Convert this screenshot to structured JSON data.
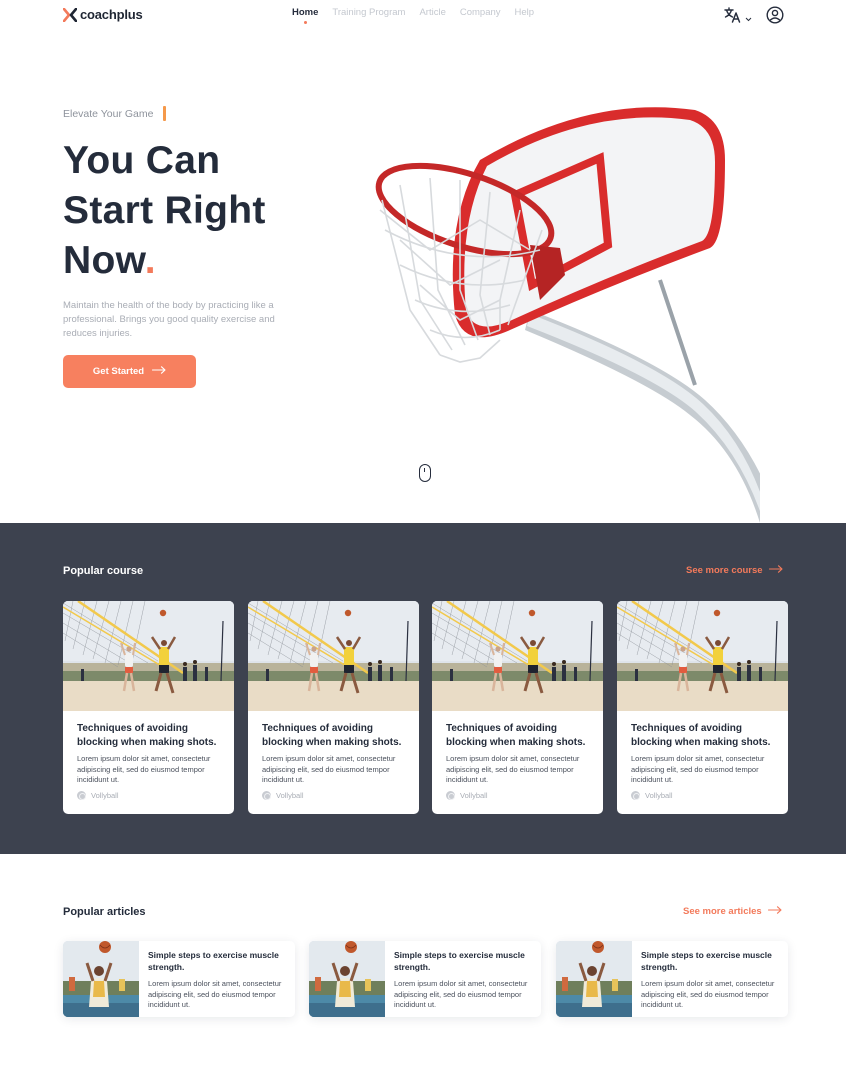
{
  "nav": {
    "logo_text": "coachplus",
    "items": [
      {
        "label": "Home",
        "active": true
      },
      {
        "label": "Training Program",
        "active": false
      },
      {
        "label": "Article",
        "active": false
      },
      {
        "label": "Company",
        "active": false
      },
      {
        "label": "Help",
        "active": false
      }
    ],
    "icons": {
      "language": "translate-icon",
      "dropdown": "chevron-down-icon",
      "account": "user-circle-icon"
    }
  },
  "hero": {
    "eyebrow": "Elevate Your Game",
    "title_line1": "You Can",
    "title_line2": "Start Right",
    "title_line3": "Now",
    "title_dot": ".",
    "description": "Maintain the health of the body by practicing like a professional. Brings you good quality exercise and reduces injuries.",
    "cta_label": "Get Started"
  },
  "courses": {
    "title": "Popular course",
    "see_more": "See more course",
    "items": [
      {
        "title": "Techniques of avoiding blocking when making shots.",
        "description": "Lorem ipsum dolor sit amet, consectetur adipiscing elit, sed do eiusmod tempor incididunt ut.",
        "tag": "Vollyball"
      },
      {
        "title": "Techniques of avoiding blocking when making shots.",
        "description": "Lorem ipsum dolor sit amet, consectetur adipiscing elit, sed do eiusmod tempor incididunt ut.",
        "tag": "Vollyball"
      },
      {
        "title": "Techniques of avoiding blocking when making shots.",
        "description": "Lorem ipsum dolor sit amet, consectetur adipiscing elit, sed do eiusmod tempor incididunt ut.",
        "tag": "Vollyball"
      },
      {
        "title": "Techniques of avoiding blocking when making shots.",
        "description": "Lorem ipsum dolor sit amet, consectetur adipiscing elit, sed do eiusmod tempor incididunt ut.",
        "tag": "Vollyball"
      }
    ]
  },
  "articles": {
    "title": "Popular articles",
    "see_more": "See more articles",
    "items": [
      {
        "title": "Simple steps to exercise muscle strength.",
        "description": "Lorem ipsum dolor sit amet, consectetur adipiscing elit, sed do eiusmod tempor incididunt ut."
      },
      {
        "title": "Simple steps to exercise muscle strength.",
        "description": "Lorem ipsum dolor sit amet, consectetur adipiscing elit, sed do eiusmod tempor incididunt ut."
      },
      {
        "title": "Simple steps to exercise muscle strength.",
        "description": "Lorem ipsum dolor sit amet, consectetur adipiscing elit, sed do eiusmod tempor incididunt ut."
      }
    ]
  },
  "colors": {
    "accent": "#f37a5b",
    "dark_section": "#3d424f",
    "heading": "#242c3b"
  }
}
